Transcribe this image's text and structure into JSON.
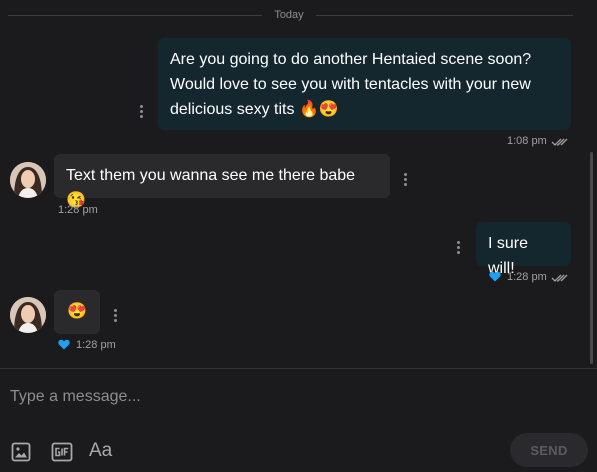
{
  "day_separator": "Today",
  "messages": [
    {
      "direction": "outgoing",
      "text": "Are you going to do another Hentaied scene soon? Would love to see you with tentacles with your new delicious sexy tits 🔥😍",
      "time": "1:08 pm",
      "status": "read"
    },
    {
      "direction": "incoming",
      "text": "Text them you wanna see me there babe 😘",
      "time": "1:28 pm"
    },
    {
      "direction": "outgoing",
      "text": "I sure will!",
      "time": "1:28 pm",
      "liked": true,
      "status": "read"
    },
    {
      "direction": "incoming",
      "text": "😍",
      "time": "1:28 pm",
      "liked": true
    }
  ],
  "composer": {
    "placeholder": "Type a message...",
    "format_label": "Aa",
    "send_label": "SEND"
  },
  "icons": {
    "image": "image-icon",
    "gif": "gif-icon",
    "more": "more-vertical-icon",
    "heart": "heart-icon",
    "read": "double-check-icon"
  },
  "colors": {
    "background": "#1b1b1d",
    "outgoing_bubble": "#14272f",
    "incoming_bubble": "#2a2a2d",
    "like": "#1da1f2"
  }
}
